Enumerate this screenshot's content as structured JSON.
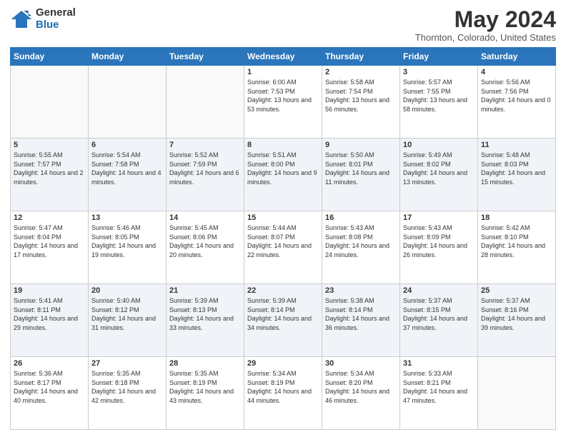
{
  "logo": {
    "general": "General",
    "blue": "Blue"
  },
  "title": {
    "month_year": "May 2024",
    "location": "Thornton, Colorado, United States"
  },
  "days_of_week": [
    "Sunday",
    "Monday",
    "Tuesday",
    "Wednesday",
    "Thursday",
    "Friday",
    "Saturday"
  ],
  "weeks": [
    [
      {
        "day": "",
        "sunrise": "",
        "sunset": "",
        "daylight": ""
      },
      {
        "day": "",
        "sunrise": "",
        "sunset": "",
        "daylight": ""
      },
      {
        "day": "",
        "sunrise": "",
        "sunset": "",
        "daylight": ""
      },
      {
        "day": "1",
        "sunrise": "Sunrise: 6:00 AM",
        "sunset": "Sunset: 7:53 PM",
        "daylight": "Daylight: 13 hours and 53 minutes."
      },
      {
        "day": "2",
        "sunrise": "Sunrise: 5:58 AM",
        "sunset": "Sunset: 7:54 PM",
        "daylight": "Daylight: 13 hours and 56 minutes."
      },
      {
        "day": "3",
        "sunrise": "Sunrise: 5:57 AM",
        "sunset": "Sunset: 7:55 PM",
        "daylight": "Daylight: 13 hours and 58 minutes."
      },
      {
        "day": "4",
        "sunrise": "Sunrise: 5:56 AM",
        "sunset": "Sunset: 7:56 PM",
        "daylight": "Daylight: 14 hours and 0 minutes."
      }
    ],
    [
      {
        "day": "5",
        "sunrise": "Sunrise: 5:55 AM",
        "sunset": "Sunset: 7:57 PM",
        "daylight": "Daylight: 14 hours and 2 minutes."
      },
      {
        "day": "6",
        "sunrise": "Sunrise: 5:54 AM",
        "sunset": "Sunset: 7:58 PM",
        "daylight": "Daylight: 14 hours and 4 minutes."
      },
      {
        "day": "7",
        "sunrise": "Sunrise: 5:52 AM",
        "sunset": "Sunset: 7:59 PM",
        "daylight": "Daylight: 14 hours and 6 minutes."
      },
      {
        "day": "8",
        "sunrise": "Sunrise: 5:51 AM",
        "sunset": "Sunset: 8:00 PM",
        "daylight": "Daylight: 14 hours and 9 minutes."
      },
      {
        "day": "9",
        "sunrise": "Sunrise: 5:50 AM",
        "sunset": "Sunset: 8:01 PM",
        "daylight": "Daylight: 14 hours and 11 minutes."
      },
      {
        "day": "10",
        "sunrise": "Sunrise: 5:49 AM",
        "sunset": "Sunset: 8:02 PM",
        "daylight": "Daylight: 14 hours and 13 minutes."
      },
      {
        "day": "11",
        "sunrise": "Sunrise: 5:48 AM",
        "sunset": "Sunset: 8:03 PM",
        "daylight": "Daylight: 14 hours and 15 minutes."
      }
    ],
    [
      {
        "day": "12",
        "sunrise": "Sunrise: 5:47 AM",
        "sunset": "Sunset: 8:04 PM",
        "daylight": "Daylight: 14 hours and 17 minutes."
      },
      {
        "day": "13",
        "sunrise": "Sunrise: 5:46 AM",
        "sunset": "Sunset: 8:05 PM",
        "daylight": "Daylight: 14 hours and 19 minutes."
      },
      {
        "day": "14",
        "sunrise": "Sunrise: 5:45 AM",
        "sunset": "Sunset: 8:06 PM",
        "daylight": "Daylight: 14 hours and 20 minutes."
      },
      {
        "day": "15",
        "sunrise": "Sunrise: 5:44 AM",
        "sunset": "Sunset: 8:07 PM",
        "daylight": "Daylight: 14 hours and 22 minutes."
      },
      {
        "day": "16",
        "sunrise": "Sunrise: 5:43 AM",
        "sunset": "Sunset: 8:08 PM",
        "daylight": "Daylight: 14 hours and 24 minutes."
      },
      {
        "day": "17",
        "sunrise": "Sunrise: 5:43 AM",
        "sunset": "Sunset: 8:09 PM",
        "daylight": "Daylight: 14 hours and 26 minutes."
      },
      {
        "day": "18",
        "sunrise": "Sunrise: 5:42 AM",
        "sunset": "Sunset: 8:10 PM",
        "daylight": "Daylight: 14 hours and 28 minutes."
      }
    ],
    [
      {
        "day": "19",
        "sunrise": "Sunrise: 5:41 AM",
        "sunset": "Sunset: 8:11 PM",
        "daylight": "Daylight: 14 hours and 29 minutes."
      },
      {
        "day": "20",
        "sunrise": "Sunrise: 5:40 AM",
        "sunset": "Sunset: 8:12 PM",
        "daylight": "Daylight: 14 hours and 31 minutes."
      },
      {
        "day": "21",
        "sunrise": "Sunrise: 5:39 AM",
        "sunset": "Sunset: 8:13 PM",
        "daylight": "Daylight: 14 hours and 33 minutes."
      },
      {
        "day": "22",
        "sunrise": "Sunrise: 5:39 AM",
        "sunset": "Sunset: 8:14 PM",
        "daylight": "Daylight: 14 hours and 34 minutes."
      },
      {
        "day": "23",
        "sunrise": "Sunrise: 5:38 AM",
        "sunset": "Sunset: 8:14 PM",
        "daylight": "Daylight: 14 hours and 36 minutes."
      },
      {
        "day": "24",
        "sunrise": "Sunrise: 5:37 AM",
        "sunset": "Sunset: 8:15 PM",
        "daylight": "Daylight: 14 hours and 37 minutes."
      },
      {
        "day": "25",
        "sunrise": "Sunrise: 5:37 AM",
        "sunset": "Sunset: 8:16 PM",
        "daylight": "Daylight: 14 hours and 39 minutes."
      }
    ],
    [
      {
        "day": "26",
        "sunrise": "Sunrise: 5:36 AM",
        "sunset": "Sunset: 8:17 PM",
        "daylight": "Daylight: 14 hours and 40 minutes."
      },
      {
        "day": "27",
        "sunrise": "Sunrise: 5:35 AM",
        "sunset": "Sunset: 8:18 PM",
        "daylight": "Daylight: 14 hours and 42 minutes."
      },
      {
        "day": "28",
        "sunrise": "Sunrise: 5:35 AM",
        "sunset": "Sunset: 8:19 PM",
        "daylight": "Daylight: 14 hours and 43 minutes."
      },
      {
        "day": "29",
        "sunrise": "Sunrise: 5:34 AM",
        "sunset": "Sunset: 8:19 PM",
        "daylight": "Daylight: 14 hours and 44 minutes."
      },
      {
        "day": "30",
        "sunrise": "Sunrise: 5:34 AM",
        "sunset": "Sunset: 8:20 PM",
        "daylight": "Daylight: 14 hours and 46 minutes."
      },
      {
        "day": "31",
        "sunrise": "Sunrise: 5:33 AM",
        "sunset": "Sunset: 8:21 PM",
        "daylight": "Daylight: 14 hours and 47 minutes."
      },
      {
        "day": "",
        "sunrise": "",
        "sunset": "",
        "daylight": ""
      }
    ]
  ]
}
